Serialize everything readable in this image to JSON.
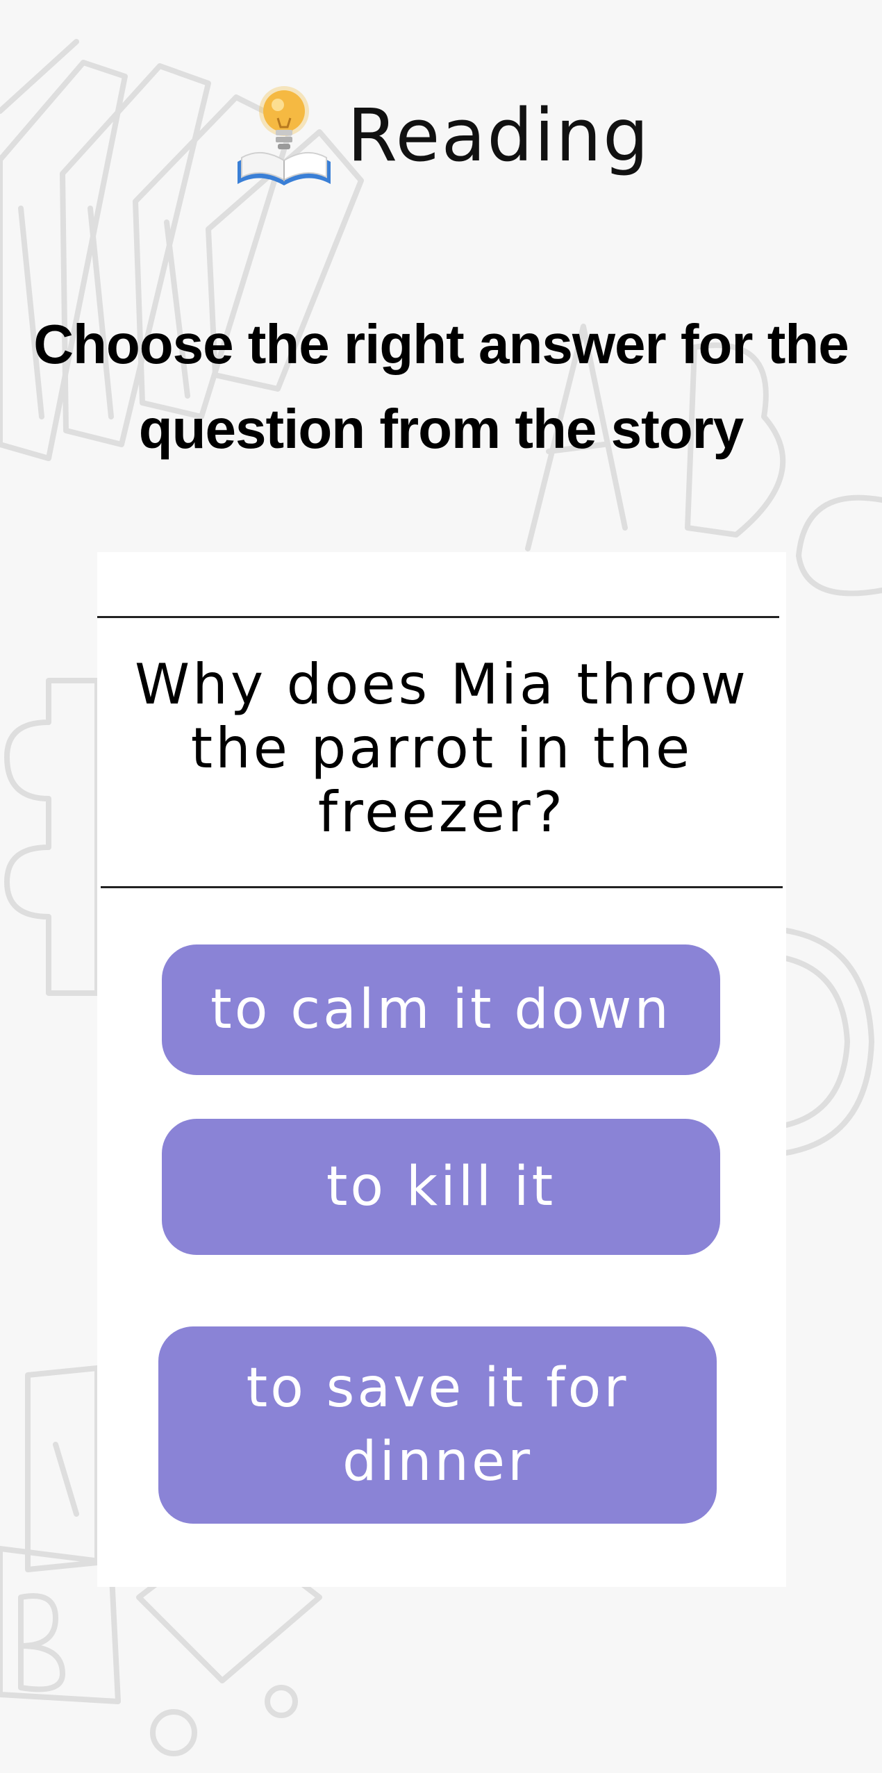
{
  "header": {
    "title": "Reading",
    "icon": "book-lightbulb-icon"
  },
  "instruction": "Choose the right answer for the question from the story",
  "quiz": {
    "question": "Why does Mia throw the parrot in the freezer?",
    "answers": [
      {
        "label": "to calm it down"
      },
      {
        "label": "to kill it"
      },
      {
        "label": "to save it for dinner"
      }
    ]
  },
  "colors": {
    "background": "#f7f7f7",
    "card": "#ffffff",
    "answer_button": "#8a83d6",
    "answer_text": "#ffffff",
    "doodle_stroke": "#dedede"
  }
}
